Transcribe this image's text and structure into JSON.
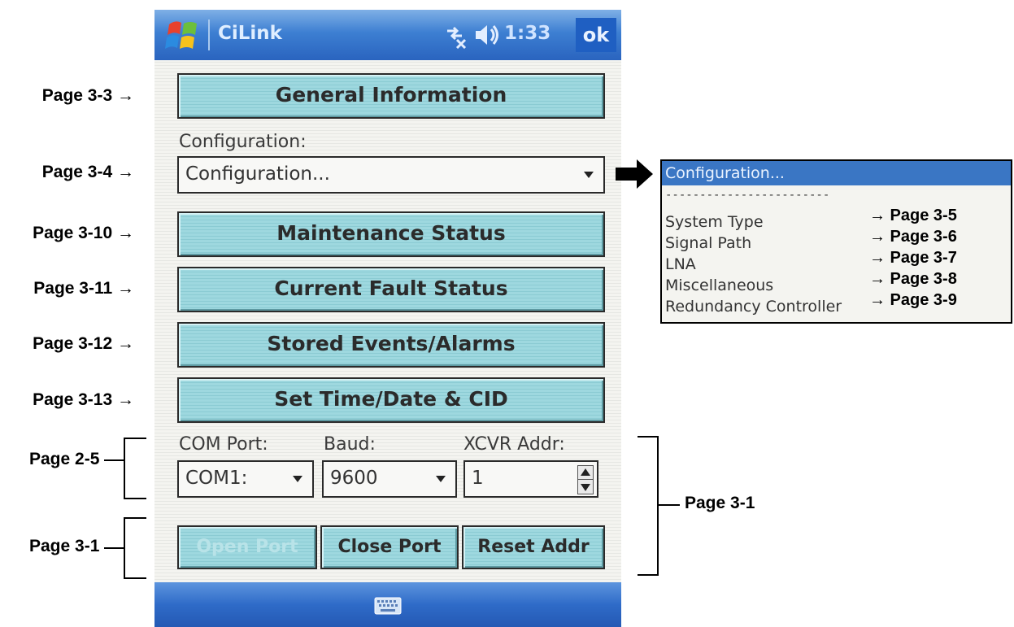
{
  "annotations_left": {
    "general": "Page 3-3 →",
    "config": "Page 3-4 →",
    "maintenance": "Page 3-10 →",
    "current_fault": "Page 3-11 →",
    "stored_events": "Page 3-12 →",
    "set_time": "Page 3-13 →",
    "com_group": "Page 2-5",
    "port_group": "Page 3-1"
  },
  "annotations_right": {
    "addr_group": "Page 3-1"
  },
  "titlebar": {
    "app_title": "CiLink",
    "clock": "1:33",
    "ok_label": "ok"
  },
  "buttons": {
    "general_information": "General Information",
    "maintenance_status": "Maintenance Status",
    "current_fault_status": "Current Fault Status",
    "stored_events_alarms": "Stored Events/Alarms",
    "set_time_date_cid": "Set Time/Date & CID"
  },
  "configuration": {
    "label": "Configuration:",
    "selected": "Configuration..."
  },
  "connection": {
    "com_port_label": "COM Port:",
    "com_port_value": "COM1:",
    "baud_label": "Baud:",
    "baud_value": "9600",
    "addr_label": "XCVR Addr:",
    "addr_value": "1"
  },
  "port_buttons": {
    "open": "Open Port",
    "close": "Close Port",
    "reset": "Reset Addr"
  },
  "popup": {
    "header": "Configuration...",
    "separator": "------------------------",
    "items": [
      {
        "label": "System Type",
        "ref": "→ Page 3-5"
      },
      {
        "label": "Signal Path",
        "ref": "→ Page 3-6"
      },
      {
        "label": "LNA",
        "ref": "→ Page 3-7"
      },
      {
        "label": "Miscellaneous",
        "ref": "→ Page 3-8"
      },
      {
        "label": "Redundancy Controller",
        "ref": "→ Page 3-9"
      }
    ]
  },
  "colors": {
    "button_face": "#9ed8df",
    "title_bar": "#3d7fd2",
    "popup_header": "#3a76c4"
  }
}
